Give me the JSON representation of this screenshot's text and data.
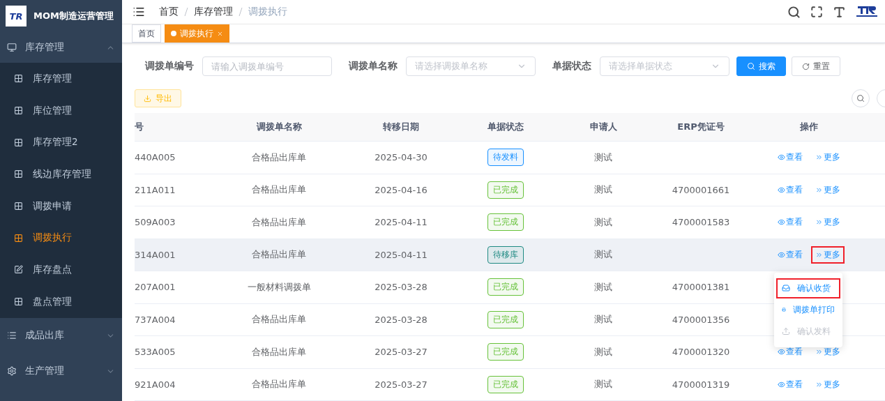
{
  "app": {
    "logo_text": "TR",
    "title": "MOM制造运营管理"
  },
  "sidebar": {
    "items": [
      {
        "label": "库存管理",
        "expanded": true,
        "children": [
          {
            "label": "库存管理",
            "selected": false
          },
          {
            "label": "库位管理",
            "selected": false
          },
          {
            "label": "库存管理2",
            "selected": false
          },
          {
            "label": "线边库存管理",
            "selected": false
          },
          {
            "label": "调拨申请",
            "selected": false
          },
          {
            "label": "调拨执行",
            "selected": true
          },
          {
            "label": "库存盘点",
            "selected": false
          },
          {
            "label": "盘点管理",
            "selected": false
          }
        ]
      },
      {
        "label": "成品出库",
        "expanded": false
      },
      {
        "label": "生产管理",
        "expanded": false
      }
    ]
  },
  "breadcrumb": [
    "首页",
    "库存管理",
    "调拨执行"
  ],
  "tags": [
    {
      "label": "首页",
      "selected": false,
      "closable": false
    },
    {
      "label": "调拨执行",
      "selected": true,
      "closable": true
    }
  ],
  "filters": [
    {
      "label": "调拨单编号",
      "kind": "input",
      "placeholder": "请输入调拨单编号"
    },
    {
      "label": "调拨单名称",
      "kind": "select",
      "placeholder": "请选择调拨单名称"
    },
    {
      "label": "单据状态",
      "kind": "select",
      "placeholder": "请选择单据状态"
    }
  ],
  "search_button": "搜索",
  "reset_button": "重置",
  "export_button": "导出",
  "table": {
    "columns": [
      "号",
      "调拨单名称",
      "转移日期",
      "单据状态",
      "申请人",
      "ERP凭证号",
      "操作"
    ],
    "rows": [
      {
        "cells": [
          "440A005",
          "合格品出库单",
          "2025-04-30"
        ],
        "status": {
          "label": "待发料",
          "color": "#1890ff"
        },
        "applicant": "测试",
        "erp": "",
        "highlighted": false,
        "actions": [
          {
            "label": "查看",
            "annotated": false
          },
          {
            "label": "更多",
            "annotated": false
          }
        ]
      },
      {
        "cells": [
          "211A011",
          "合格品出库单",
          "2025-04-16"
        ],
        "status": {
          "label": "已完成",
          "color": "#67c23a"
        },
        "applicant": "测试",
        "erp": "4700001661",
        "highlighted": false,
        "actions": [
          {
            "label": "查看",
            "annotated": false
          },
          {
            "label": "更多",
            "annotated": false
          }
        ]
      },
      {
        "cells": [
          "509A003",
          "合格品出库单",
          "2025-04-11"
        ],
        "status": {
          "label": "已完成",
          "color": "#67c23a"
        },
        "applicant": "测试",
        "erp": "4700001583",
        "highlighted": false,
        "actions": [
          {
            "label": "查看",
            "annotated": false
          },
          {
            "label": "更多",
            "annotated": false
          }
        ]
      },
      {
        "cells": [
          "314A001",
          "合格品出库单",
          "2025-04-11"
        ],
        "status": {
          "label": "待移库",
          "color": "#1f8a83"
        },
        "applicant": "测试",
        "erp": "",
        "highlighted": true,
        "actions": [
          {
            "label": "查看",
            "annotated": false
          },
          {
            "label": "更多",
            "annotated": true
          }
        ],
        "menu": [
          {
            "label": "确认收货",
            "disabled": false,
            "annotated": true
          },
          {
            "label": "调拨单打印",
            "disabled": false,
            "annotated": false
          },
          {
            "label": "确认发料",
            "disabled": true,
            "annotated": false
          }
        ]
      },
      {
        "cells": [
          "207A001",
          "一般材料调拨单",
          "2025-03-28"
        ],
        "status": {
          "label": "已完成",
          "color": "#67c23a"
        },
        "applicant": "测试",
        "erp": "4700001381",
        "highlighted": false,
        "actions": []
      },
      {
        "cells": [
          "737A004",
          "合格品出库单",
          "2025-03-28"
        ],
        "status": {
          "label": "已完成",
          "color": "#67c23a"
        },
        "applicant": "测试",
        "erp": "4700001356",
        "highlighted": false,
        "actions": []
      },
      {
        "cells": [
          "533A005",
          "合格品出库单",
          "2025-03-27"
        ],
        "status": {
          "label": "已完成",
          "color": "#67c23a"
        },
        "applicant": "测试",
        "erp": "4700001320",
        "highlighted": false,
        "actions": [
          {
            "label": "查看",
            "annotated": false
          },
          {
            "label": "更多",
            "annotated": false
          }
        ]
      },
      {
        "cells": [
          "921A004",
          "合格品出库单",
          "2025-03-27"
        ],
        "status": {
          "label": "已完成",
          "color": "#67c23a"
        },
        "applicant": "测试",
        "erp": "4700001319",
        "highlighted": false,
        "actions": [
          {
            "label": "查看",
            "annotated": false
          },
          {
            "label": "更多",
            "annotated": false
          }
        ]
      }
    ]
  }
}
